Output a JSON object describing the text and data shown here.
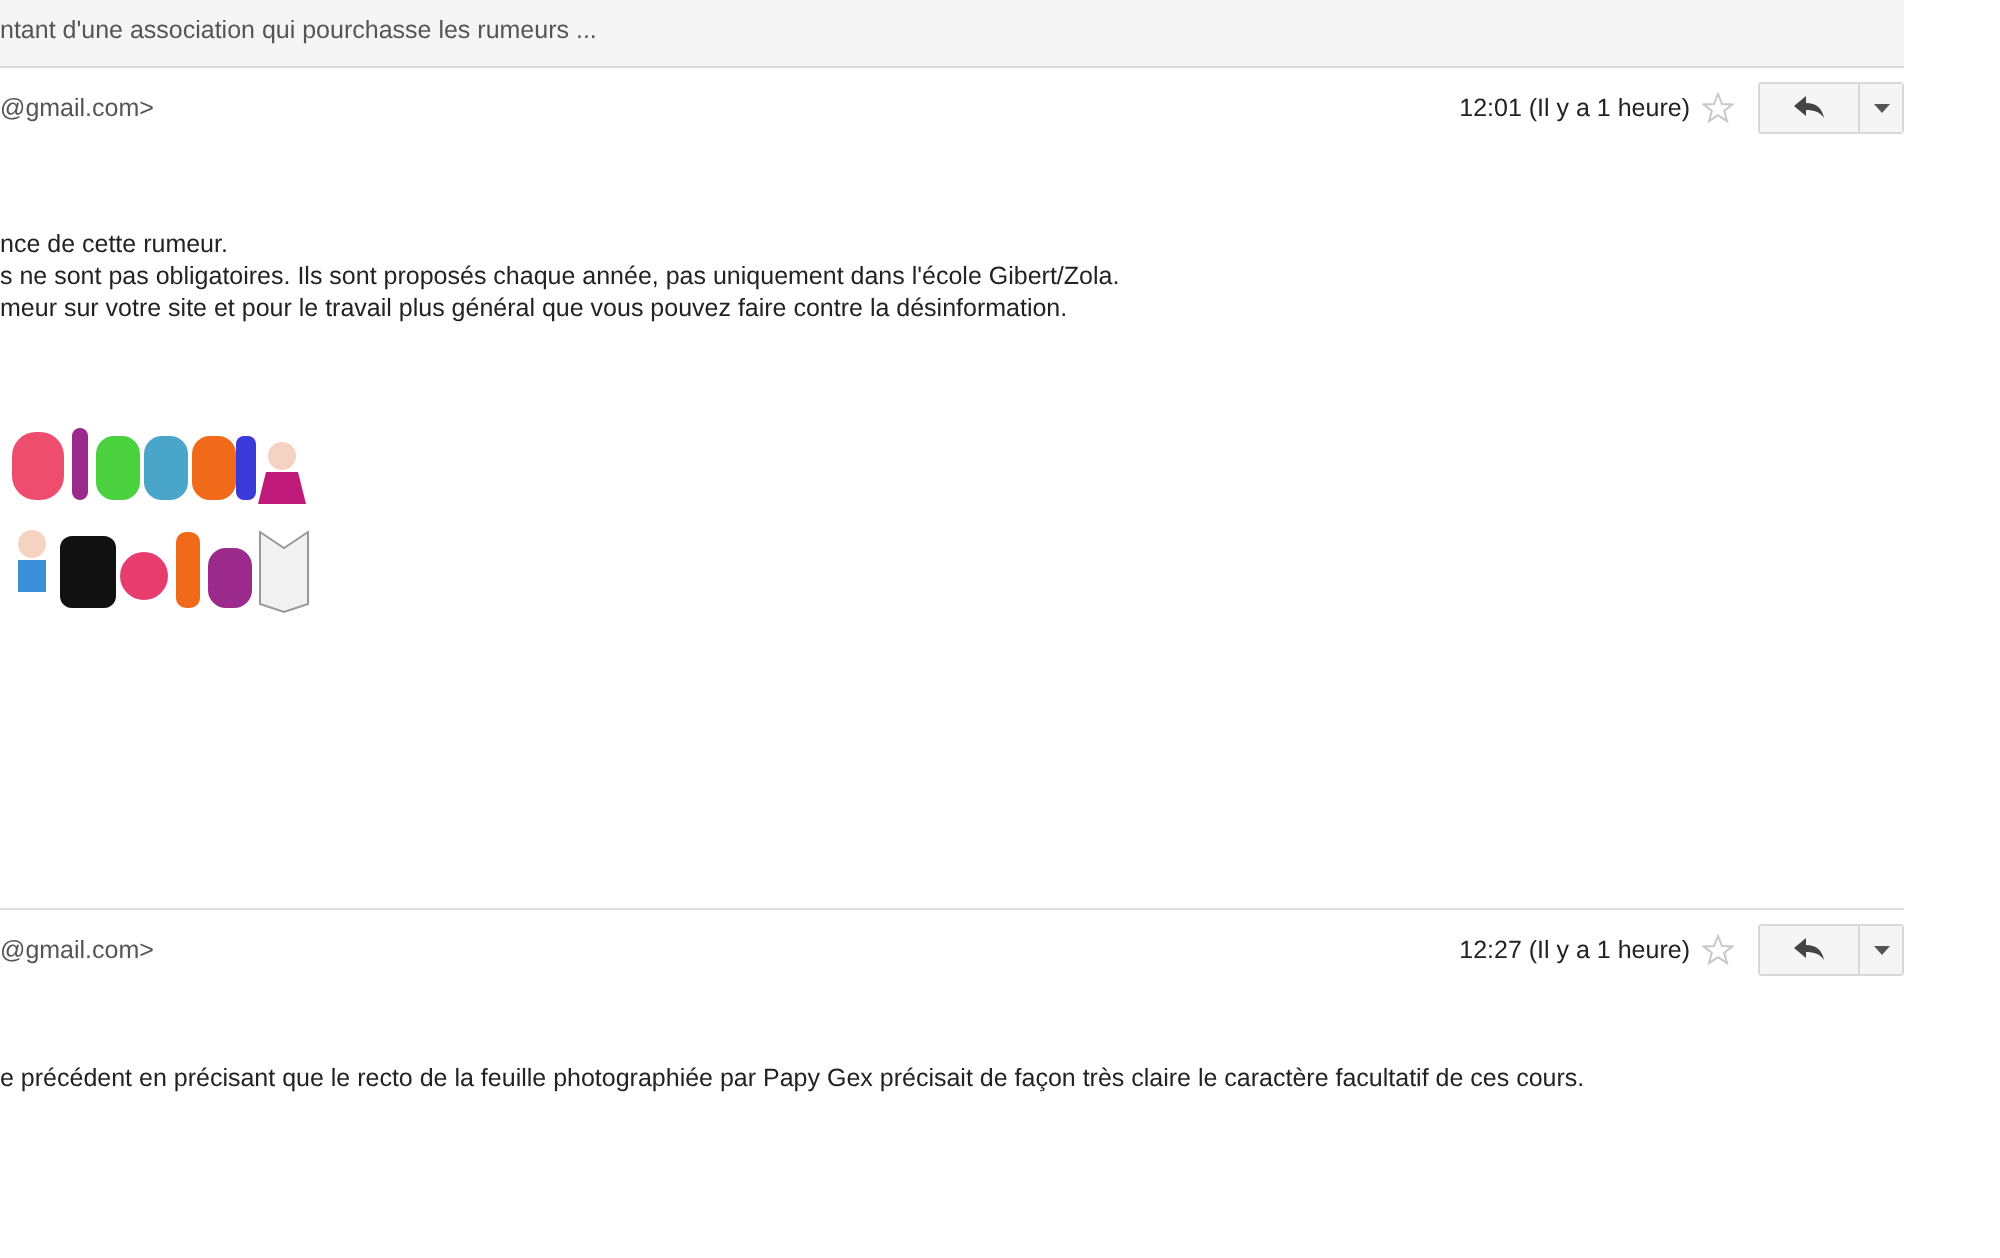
{
  "subject": "ntant d'une association qui pourchasse les rumeurs ...",
  "messages": [
    {
      "sender": "@gmail.com>",
      "time": "12:01 (Il y a 1 heure)",
      "starred": false,
      "body": [
        "nce de cette rumeur.",
        "s ne sont pas obligatoires. Ils sont proposés chaque année, pas uniquement dans l'école Gibert/Zola.",
        "meur sur votre site et pour le travail plus général que vous pouvez faire contre la désinformation."
      ]
    },
    {
      "sender": "@gmail.com>",
      "time": "12:27 (Il y a 1 heure)",
      "starred": false,
      "body": [
        "e précédent en précisant que le recto de la feuille photographiée par Papy Gex précisait de façon très claire le caractère facultatif de ces cours."
      ]
    }
  ]
}
